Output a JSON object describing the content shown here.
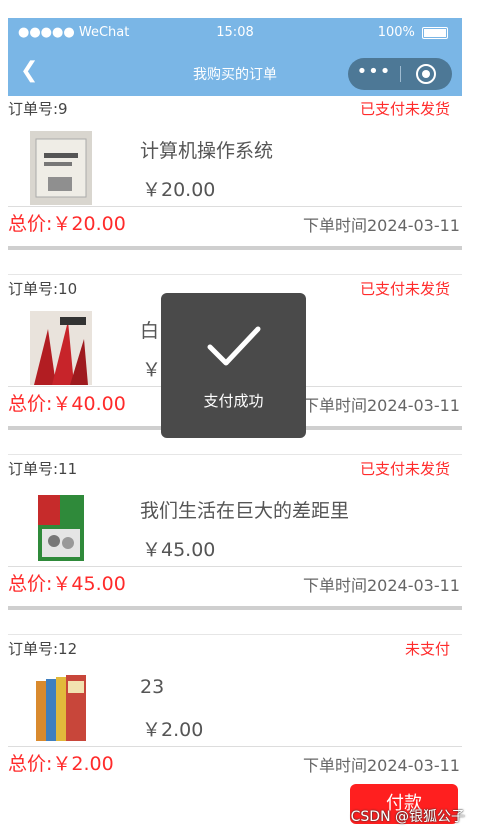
{
  "status_bar": {
    "carrier": "●●●●● WeChat",
    "time": "15:08",
    "battery": "100%"
  },
  "nav": {
    "title": "我购买的订单",
    "capsule_more": "•••"
  },
  "orders": [
    {
      "order_no": "订单号:9",
      "status": "已支付未发货",
      "title": "计算机操作系统",
      "price": "￥20.00",
      "total": "总价:￥20.00",
      "time": "下单时间2024-03-11"
    },
    {
      "order_no": "订单号:10",
      "status": "已支付未发货",
      "title": "白",
      "price": "￥",
      "total": "总价:￥40.00",
      "time": "下单时间2024-03-11"
    },
    {
      "order_no": "订单号:11",
      "status": "已支付未发货",
      "title": "我们生活在巨大的差距里",
      "price": "￥45.00",
      "total": "总价:￥45.00",
      "time": "下单时间2024-03-11"
    },
    {
      "order_no": "订单号:12",
      "status": "未支付",
      "title": "23",
      "price": "￥2.00",
      "total": "总价:￥2.00",
      "time": "下单时间2024-03-11"
    }
  ],
  "pay_button": "付款",
  "toast": {
    "text": "支付成功"
  },
  "watermark": "CSDN @银狐公子",
  "colors": {
    "header": "#7ab6e6",
    "accent_red": "#ff2b2b",
    "toast_bg": "#4a4a4a"
  }
}
